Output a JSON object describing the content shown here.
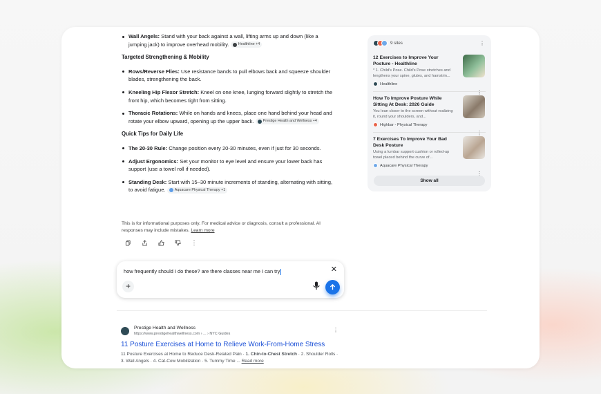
{
  "answer": {
    "wall_angels": {
      "title": "Wall Angels:",
      "text": "Stand with your back against a wall, lifting arms up and down (like a jumping jack) to improve overhead mobility.",
      "cite": "Healthline +4"
    },
    "section1": "Targeted Strengthening & Mobility",
    "rows": {
      "title": "Rows/Reverse Flies:",
      "text": "Use resistance bands to pull elbows back and squeeze shoulder blades, strengthening the back."
    },
    "hip": {
      "title": "Kneeling Hip Flexor Stretch:",
      "text": "Kneel on one knee, lunging forward slightly to stretch the front hip, which becomes tight from sitting."
    },
    "thoracic": {
      "title": "Thoracic Rotations:",
      "text": "While on hands and knees, place one hand behind your head and rotate your elbow upward, opening up the upper back.",
      "cite": "Prestige Health and Wellness +4"
    },
    "section2": "Quick Tips for Daily Life",
    "rule": {
      "title": "The 20-30 Rule:",
      "text": "Change position every 20-30 minutes, even if just for 30 seconds."
    },
    "ergonomics": {
      "title": "Adjust Ergonomics:",
      "text": "Set your monitor to eye level and ensure your lower back has support (use a towel roll if needed)."
    },
    "desk": {
      "title": "Standing Desk:",
      "text": "Start with 15–30 minute increments of standing, alternating with sitting, to avoid fatigue.",
      "cite": "Aquacare Physical Therapy +1"
    }
  },
  "disclaimer": {
    "text": "This is for informational purposes only. For medical advice or diagnosis, consult a professional. AI responses may include mistakes.",
    "link": "Learn more"
  },
  "sources": {
    "count": "9 sites",
    "items": [
      {
        "title": "12 Exercises to Improve Your Posture - Healthline",
        "desc": "* 1. Child's Pose. Child's Pose stretches and lengthens your spine, glutes, and hamstrin...",
        "site": "Healthline"
      },
      {
        "title": "How To Improve Posture While Sitting At Desk: 2026 Guide",
        "desc": "You lean closer to the screen without realizing it, round your shoulders, and...",
        "site": "Highbar - Physical Therapy"
      },
      {
        "title": "7 Exercises To Improve Your Bad Desk Posture",
        "desc": "Using a lumbar support cushion or rolled-up towel placed behind the curve of...",
        "site": "Aquacare Physical Therapy"
      }
    ],
    "show_all": "Show all"
  },
  "composer": {
    "query": "how frequently should I do these? are there classes near me I can try",
    "plus": "+",
    "close": "✕"
  },
  "result": {
    "site_name": "Prestige Health and Wellness",
    "url": "https://www.prestigehealthwellness.com › ... › NYC Guides",
    "title": "11 Posture Exercises at Home to Relieve Work-From-Home Stress",
    "snippet_a": "11 Posture Exercises at Home to Reduce Desk-Related Pain",
    "snippet_b": " · ",
    "snippet_bold": "1. Chin-to-Chest Stretch",
    "snippet_c": " · 2. Shoulder Rolls · 3. Wall Angels · 4. Cat-Cow Mobilization · 5. Tummy Time ... ",
    "read_more": "Read more"
  },
  "kebab": "⋮"
}
